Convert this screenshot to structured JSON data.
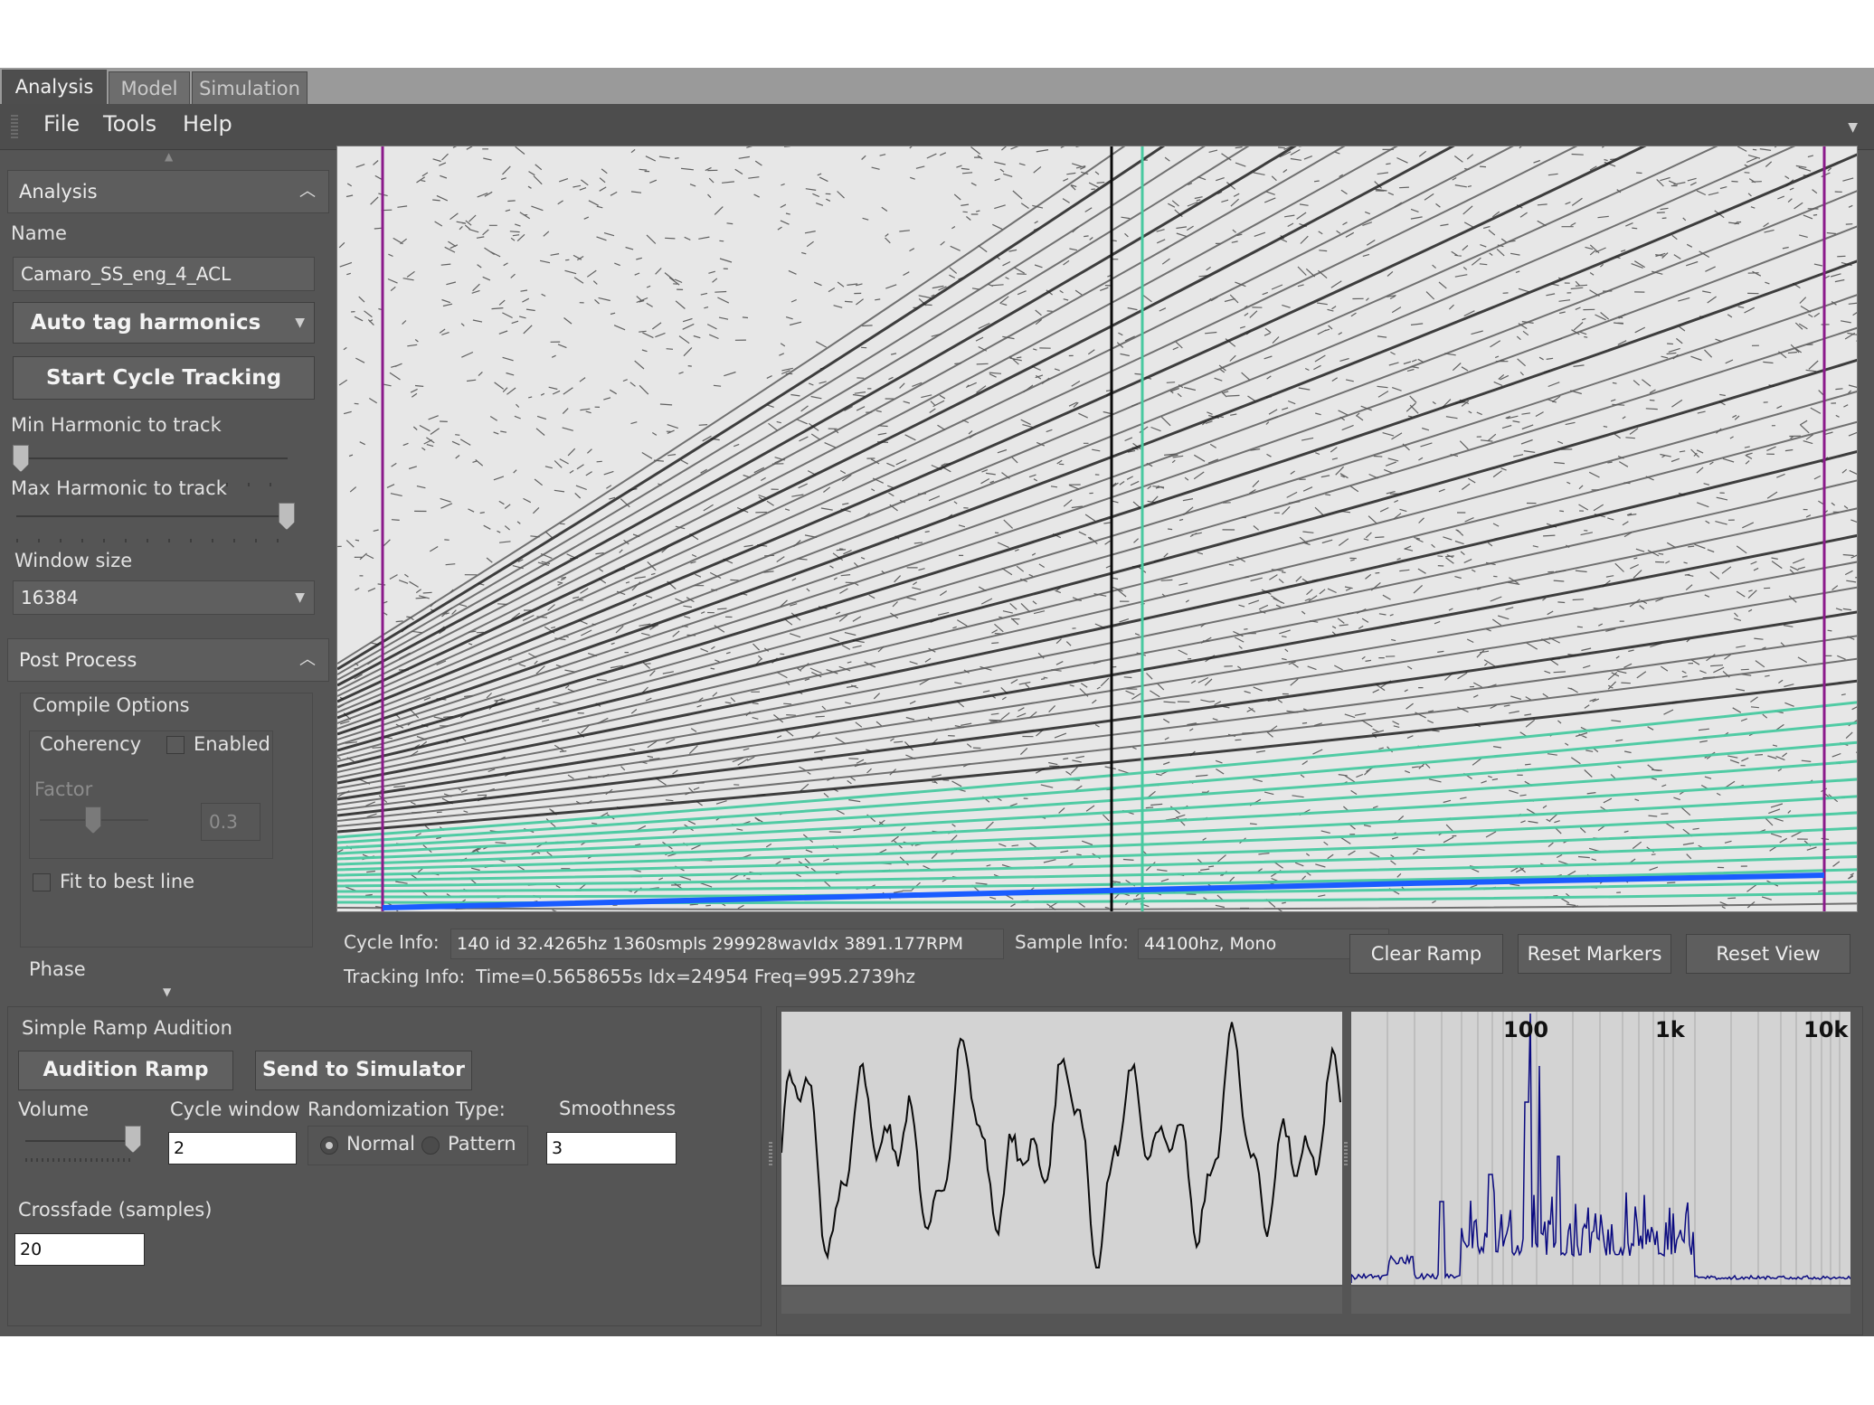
{
  "tabs": [
    "Analysis",
    "Model",
    "Simulation"
  ],
  "menu": [
    "File",
    "Tools",
    "Help"
  ],
  "analysis_rollout": {
    "title": "Analysis",
    "name_label": "Name",
    "name_value": "Camaro_SS_eng_4_ACL",
    "auto_tag_label": "Auto tag harmonics",
    "start_tracking_label": "Start Cycle Tracking",
    "min_harmonic_label": "Min Harmonic to track",
    "max_harmonic_label": "Max Harmonic to track",
    "window_size_label": "Window size",
    "window_size_value": "16384"
  },
  "post_process": {
    "title": "Post Process",
    "compile_options_label": "Compile Options",
    "coherency_label": "Coherency",
    "enabled_label": "Enabled",
    "factor_label": "Factor",
    "factor_value": "0.3",
    "fit_best_line_label": "Fit to best line",
    "phase_label": "Phase"
  },
  "info": {
    "cycle_info_label": "Cycle Info:",
    "cycle_info_value": "140 id  32.4265hz  1360smpls  299928wavIdx  3891.177RPM",
    "sample_info_label": "Sample Info:",
    "sample_info_value": "44100hz, Mono",
    "tracking_info_label": "Tracking Info:",
    "tracking_info_value": "Time=0.5658655s  Idx=24954  Freq=995.2739hz"
  },
  "view_buttons": {
    "clear_ramp": "Clear Ramp",
    "reset_markers": "Reset Markers",
    "reset_view": "Reset View"
  },
  "audition": {
    "title": "Simple Ramp Audition",
    "audition_ramp_label": "Audition Ramp",
    "send_to_simulator_label": "Send to Simulator",
    "volume_label": "Volume",
    "cycle_window_label": "Cycle window",
    "cycle_window_value": "2",
    "randomization_label": "Randomization Type:",
    "normal_label": "Normal",
    "pattern_label": "Pattern",
    "smoothness_label": "Smoothness",
    "smoothness_value": "3",
    "crossfade_label": "Crossfade (samples)",
    "crossfade_value": "20"
  },
  "spectrum_labels": [
    "100",
    "1k",
    "10k"
  ],
  "colors": {
    "app_bg": "#555555",
    "harmonic_tag": "#48c9a0",
    "ramp_line": "#1a5cff",
    "marker": "#8b1a8b",
    "spectrum_trace": "#0a0a80"
  },
  "icons": {
    "collapse": "chevron-up-icon",
    "dropdown": "chevron-down-icon",
    "overflow": "triangle-down-icon"
  }
}
